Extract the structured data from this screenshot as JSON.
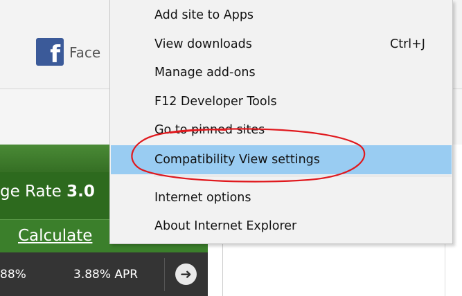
{
  "background": {
    "facebook_icon": "f",
    "facebook_text": "Face",
    "rate_prefix": "ge Rate ",
    "rate_value": "3.0",
    "calculate_link": "Calculate",
    "apr_left": "88%",
    "apr_right": "3.88% APR",
    "arrow_icon": "arrow-right-icon"
  },
  "menu": {
    "items": [
      {
        "label": "Add site to Apps",
        "shortcut": ""
      },
      {
        "label": "View downloads",
        "shortcut": "Ctrl+J"
      },
      {
        "label": "Manage add-ons",
        "shortcut": ""
      },
      {
        "label": "F12 Developer Tools",
        "shortcut": ""
      },
      {
        "label": "Go to pinned sites",
        "shortcut": ""
      },
      {
        "label": "Compatibility View settings",
        "shortcut": "",
        "highlighted": true
      },
      {
        "label": "Internet options",
        "shortcut": ""
      },
      {
        "label": "About Internet Explorer",
        "shortcut": ""
      }
    ]
  },
  "colors": {
    "highlight": "#99ccf2",
    "annotation": "#e0191e",
    "facebook_blue": "#3b5a99",
    "green": "#3b7f2b"
  }
}
